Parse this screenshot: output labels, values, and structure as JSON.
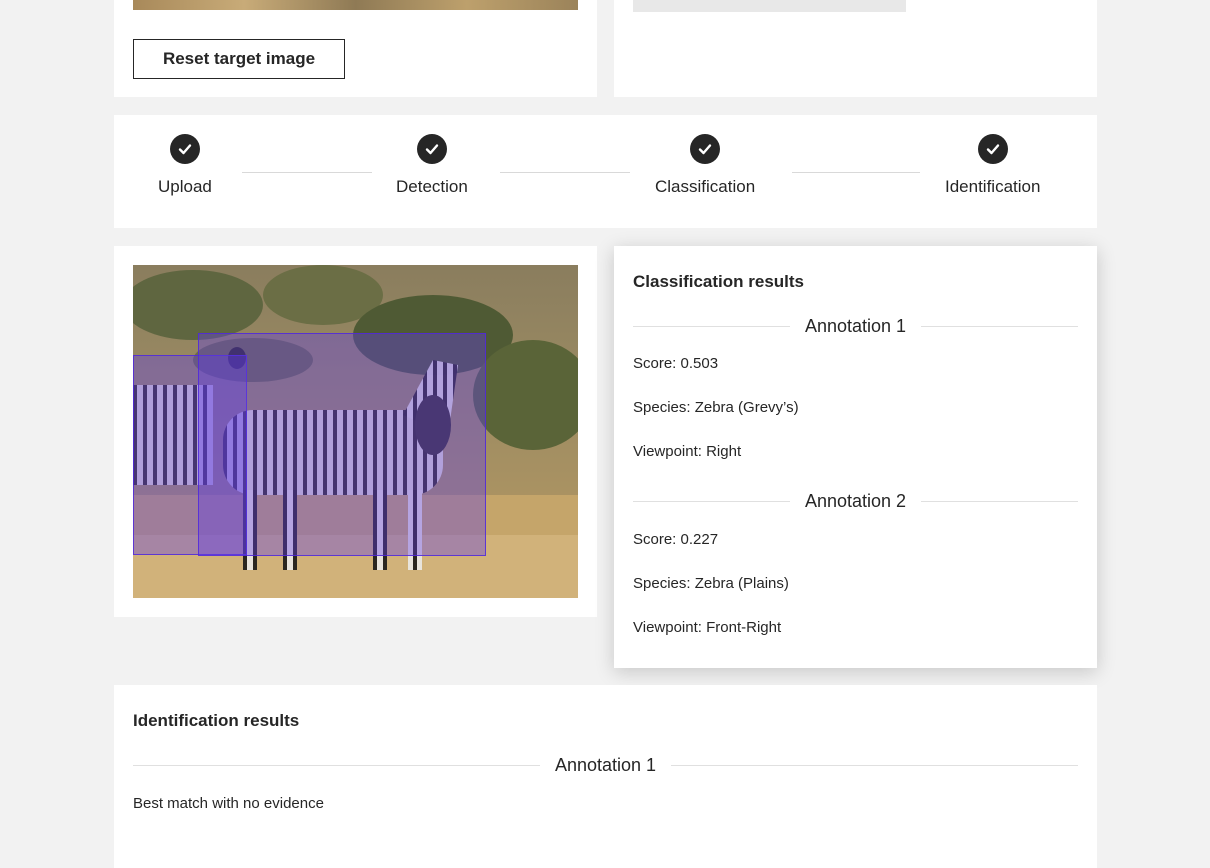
{
  "top_left": {
    "reset_label": "Reset target image"
  },
  "stepper": {
    "steps": [
      {
        "label": "Upload",
        "icon": "check-icon",
        "state": "complete"
      },
      {
        "label": "Detection",
        "icon": "check-icon",
        "state": "complete"
      },
      {
        "label": "Classification",
        "icon": "check-icon",
        "state": "complete"
      },
      {
        "label": "Identification",
        "icon": "check-icon",
        "state": "complete"
      }
    ]
  },
  "colors": {
    "page_bg": "#f2f2f2",
    "text": "#262626",
    "bbox_fill": "rgba(96, 60, 235, 0.38)"
  },
  "classification": {
    "title": "Classification results",
    "annotations": [
      {
        "heading": "Annotation 1",
        "score": "Score: 0.503",
        "species": "Species: Zebra (Grevy’s)",
        "viewpoint": "Viewpoint: Right"
      },
      {
        "heading": "Annotation 2",
        "score": "Score: 0.227",
        "species": "Species: Zebra (Plains)",
        "viewpoint": "Viewpoint: Front-Right"
      }
    ]
  },
  "identification": {
    "title": "Identification results",
    "annotations": [
      {
        "heading": "Annotation 1",
        "result": "Best match with no evidence"
      }
    ]
  }
}
